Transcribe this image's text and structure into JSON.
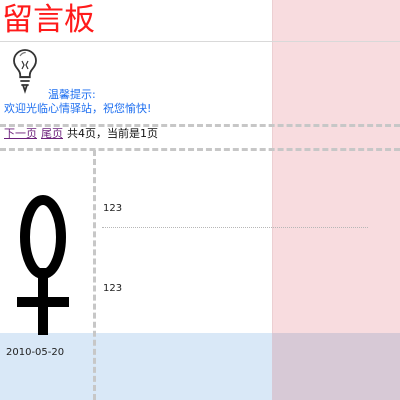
{
  "page": {
    "title": "留言板"
  },
  "notice": {
    "title": "温馨提示:",
    "body": "欢迎光临心情驿站，祝您愉快!"
  },
  "pager": {
    "next": "下一页",
    "last": "尾页",
    "info": "共4页，当前是1页"
  },
  "messages": [
    {
      "avatar": "female-symbol-icon",
      "line1": "123",
      "line2": "123",
      "date": "2010-05-20"
    }
  ],
  "colors": {
    "title": "#ff1a1a",
    "notice": "#1e6ff0",
    "link": "#6b1f7a",
    "right_band": "#f8dcdf",
    "bottom_band": "#d9e8f7"
  }
}
